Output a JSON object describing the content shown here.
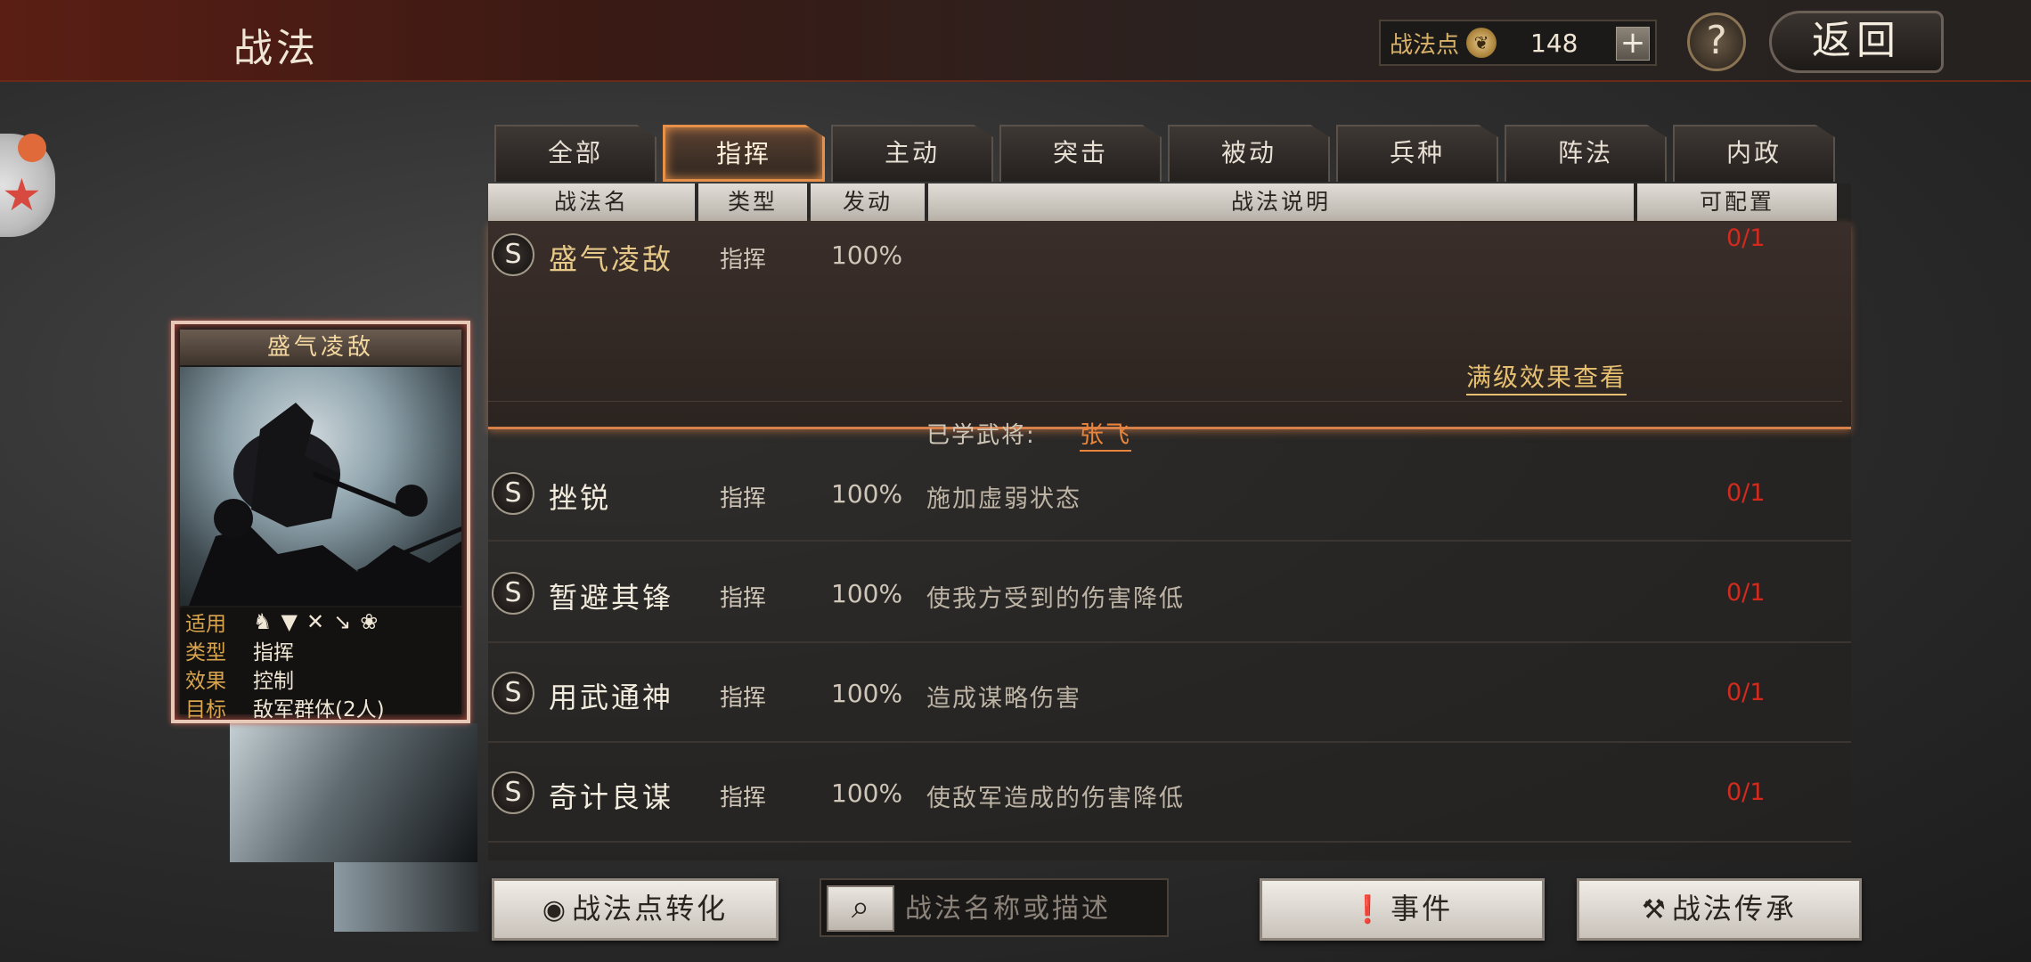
{
  "header": {
    "title": "战法",
    "points_label": "战法点",
    "points_value": "148",
    "plus_label": "+",
    "help_label": "?",
    "back_label": "返回"
  },
  "tabs": [
    {
      "label": "全部",
      "active": false
    },
    {
      "label": "指挥",
      "active": true
    },
    {
      "label": "主动",
      "active": false
    },
    {
      "label": "突击",
      "active": false
    },
    {
      "label": "被动",
      "active": false
    },
    {
      "label": "兵种",
      "active": false
    },
    {
      "label": "阵法",
      "active": false
    },
    {
      "label": "内政",
      "active": false
    }
  ],
  "table_headers": {
    "name": "战法名",
    "type": "类型",
    "rate": "发动",
    "desc": "战法说明",
    "config": "可配置"
  },
  "selected_skill": {
    "badge": "S",
    "name": "盛气凌敌",
    "type": "指挥",
    "rate": "100%",
    "config": "0/1",
    "maxlevel_link": "满级效果查看",
    "learned_label": "已学武将:",
    "learned_name": "张飞"
  },
  "skills": [
    {
      "badge": "S",
      "name": "挫锐",
      "type": "指挥",
      "rate": "100%",
      "desc": "施加虚弱状态",
      "config": "0/1"
    },
    {
      "badge": "S",
      "name": "暂避其锋",
      "type": "指挥",
      "rate": "100%",
      "desc": "使我方受到的伤害降低",
      "config": "0/1"
    },
    {
      "badge": "S",
      "name": "用武通神",
      "type": "指挥",
      "rate": "100%",
      "desc": "造成谋略伤害",
      "config": "0/1"
    },
    {
      "badge": "S",
      "name": "奇计良谋",
      "type": "指挥",
      "rate": "100%",
      "desc": "使敌军造成的伤害降低",
      "config": "0/1"
    }
  ],
  "card": {
    "title": "盛气凌敌",
    "rows": [
      {
        "key": "适用",
        "value": ""
      },
      {
        "key": "类型",
        "value": "指挥"
      },
      {
        "key": "效果",
        "value": "控制"
      },
      {
        "key": "目标",
        "value": "敌军群体(2人)"
      }
    ],
    "unit_icons": [
      "cavalry-icon",
      "shield-icon",
      "bow-icon",
      "spear-icon",
      "wheel-icon"
    ]
  },
  "bottom": {
    "convert_label": "战法点转化",
    "search_placeholder": "战法名称或描述",
    "event_label": "事件",
    "inherit_label": "战法传承"
  },
  "colors": {
    "accent_orange": "#e6904a",
    "config_red": "#d22a1e",
    "gold_text": "#e6c070"
  }
}
